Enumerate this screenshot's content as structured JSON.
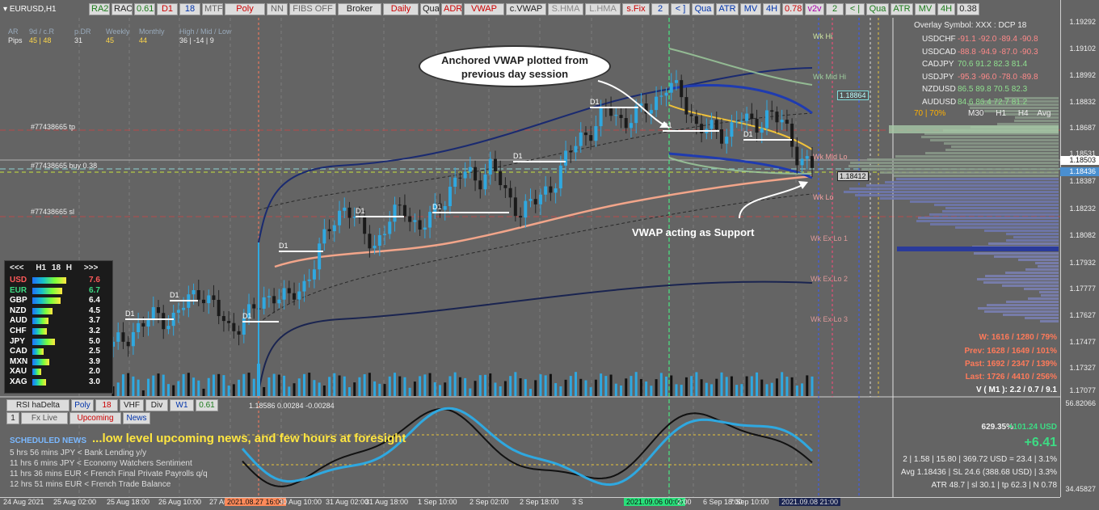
{
  "symbol": "EURUSD,H1",
  "toolbar": [
    "RA2",
    "RAC",
    "0.61",
    "D1",
    "18",
    "MTF",
    "Poly",
    "NN",
    "FIBS OFF",
    "Broker",
    "Daily",
    "Qua",
    "ADR",
    "VWAP",
    "c.VWAP",
    "S.HMA",
    "L.HMA",
    "s.Fix",
    "2",
    "< ]",
    "Qua",
    "ATR",
    "MV",
    "4H",
    "0.78",
    "v2v",
    "2",
    "< |",
    "Qua",
    "ATR",
    "MV",
    "4H",
    "0.38"
  ],
  "stats": {
    "header": [
      "AR",
      "9d / c.R",
      "p.DR",
      "Weekly",
      "Monthly",
      "High / Mid / Low"
    ],
    "pips_label": "Pips",
    "values": [
      "45 | 48",
      "31",
      "45",
      "44",
      "36 | -14 | 9"
    ]
  },
  "trade_lines": {
    "tp": "#77438665 tp",
    "buy": "#77438665 buy 0.38",
    "sl": "#77438665 sl"
  },
  "callouts": {
    "vwap_anchor": "Anchored VWAP plotted from previous day session",
    "vwap_support": "VWAP acting as Support"
  },
  "levels": [
    "Wk Hi",
    "Wk Mid Hi",
    "Wk Mid Lo",
    "Wk Lo",
    "Wk Ex Lo 1",
    "Wk Ex Lo 2",
    "Wk Ex Lo 3"
  ],
  "price_boxes": {
    "upper": "1.18864",
    "lower": "1.18412"
  },
  "d1_label": "D1",
  "strength": {
    "header": [
      "<<<",
      "H1",
      "18",
      "H",
      ">>>"
    ],
    "rows": [
      {
        "ccy": "USD",
        "val": "7.6",
        "color": "#ff5a5a"
      },
      {
        "ccy": "EUR",
        "val": "6.7",
        "color": "#3ddc84"
      },
      {
        "ccy": "GBP",
        "val": "6.4",
        "color": "#ffffff"
      },
      {
        "ccy": "NZD",
        "val": "4.5",
        "color": "#ffffff"
      },
      {
        "ccy": "AUD",
        "val": "3.7",
        "color": "#ffffff"
      },
      {
        "ccy": "CHF",
        "val": "3.2",
        "color": "#ffffff"
      },
      {
        "ccy": "JPY",
        "val": "5.0",
        "color": "#ffffff"
      },
      {
        "ccy": "CAD",
        "val": "2.5",
        "color": "#ffffff"
      },
      {
        "ccy": "MXN",
        "val": "3.9",
        "color": "#ffffff"
      },
      {
        "ccy": "XAU",
        "val": "2.0",
        "color": "#ffffff"
      },
      {
        "ccy": "XAG",
        "val": "3.0",
        "color": "#ffffff"
      }
    ]
  },
  "overlay": {
    "title": "Overlay Symbol: XXX : DCP 18",
    "rows": [
      {
        "sym": "USDCHF",
        "vals": "-91.1  -92.0  -89.4  -90.8",
        "color": "#ff8a8a"
      },
      {
        "sym": "USDCAD",
        "vals": "-88.8  -94.9  -87.0  -90.3",
        "color": "#ff8a8a"
      },
      {
        "sym": "CADJPY",
        "vals": "70.6  91.2  82.3  81.4",
        "color": "#8fe08f"
      },
      {
        "sym": "USDJPY",
        "vals": "-95.3  -96.0  -78.0  -89.8",
        "color": "#ff8a8a"
      },
      {
        "sym": "NZDUSD",
        "vals": "86.5  89.8  70.5  82.3",
        "color": "#8fe08f"
      },
      {
        "sym": "AUDUSD",
        "vals": "84.6  86.4  72.7  81.2",
        "color": "#8fe08f"
      }
    ],
    "footer_pct": "70 | 70%",
    "footer_cols": [
      "M30",
      "H1",
      "H4",
      "Avg"
    ]
  },
  "perf": {
    "w": "W: 1616 / 1280 / 79%",
    "prev": "Prev: 1628 / 1649 / 101%",
    "past": "Past: 1692 / 2347 / 139%",
    "last": "Last: 1726 / 4410 / 256%",
    "v": "V ( M1 ): 2.2 / 0.7 / 9.1"
  },
  "y_axis": [
    "1.19292",
    "1.19102",
    "1.18992",
    "1.18832",
    "1.18687",
    "1.18531",
    "1.18503",
    "1.18436",
    "1.18387",
    "1.18232",
    "1.18082",
    "1.17932",
    "1.17777",
    "1.17627",
    "1.17477",
    "1.17327",
    "1.17077"
  ],
  "y_axis_hl": {
    "price": "1.18503",
    "bid": "1.18436"
  },
  "sub_y_axis": [
    "56.82066",
    "34.45827"
  ],
  "x_axis": [
    "24 Aug 2021",
    "25 Aug 02:00",
    "25 Aug 18:00",
    "26 Aug 10:00",
    "27 Aug",
    "2021.08.27 16:00",
    "30 Aug 10:00",
    "31 Aug 02:00",
    "31 Aug 18:00",
    "1 Sep 10:00",
    "2 Sep 02:00",
    "2 Sep 18:00",
    "3 S",
    "2021.09.06 00:00",
    "2:00",
    "6 Sep 18:00",
    "7 Sep 10:00",
    "2021.09.08 21:00"
  ],
  "sub_toolbar": [
    "RSI haDelta",
    "Poly",
    "18",
    "VHF",
    "Div",
    "W1",
    "0.61"
  ],
  "sub_values": "1.18586 0.00284 -0.00284",
  "sub_tabs": [
    "1",
    "Fx Live",
    "Upcoming",
    "News"
  ],
  "news": {
    "title": "SCHEDULED NEWS",
    "comment": "...low level upcoming news, and few hours at foresight",
    "items": [
      "5 hrs 56 mins  JPY  <  Bank Lending y/y",
      "11 hrs 6 mins  JPY  <  Economy Watchers Sentiment",
      "11 hrs 36 mins  EUR  <  French Final Private Payrolls q/q",
      "12 hrs 51 mins  EUR  <  French Trade Balance"
    ]
  },
  "account": {
    "pct": "629.35%",
    "usd": "+101.24 USD",
    "pl": "+6.41",
    "line1": "2  |  1.58  |  15.80  |  369.72 USD = 23.4  |  3.1%",
    "line2": "Avg 1.18436  |  SL 24.6 (388.68 USD)  |  3.3%",
    "line3": "ATR 48.7  |  sl 30.1  |  tp 62.3  |  N 0.78"
  },
  "chart_data": {
    "type": "candlestick",
    "symbol": "EURUSD",
    "timeframe": "H1",
    "ylim": [
      1.1705,
      1.1935
    ],
    "close_series": [
      1.1735,
      1.1742,
      1.1748,
      1.1755,
      1.175,
      1.1762,
      1.177,
      1.1758,
      1.1745,
      1.1752,
      1.176,
      1.1768,
      1.1763,
      1.1771,
      1.179,
      1.181,
      1.1822,
      1.1805,
      1.1797,
      1.1812,
      1.182,
      1.1806,
      1.1815,
      1.183,
      1.1841,
      1.1836,
      1.1846,
      1.1826,
      1.1818,
      1.1823,
      1.1832,
      1.1847,
      1.1862,
      1.1868,
      1.188,
      1.1872,
      1.1876,
      1.1882,
      1.1894,
      1.1888,
      1.187,
      1.1866,
      1.1864,
      1.1875,
      1.1868,
      1.1878,
      1.187,
      1.1852,
      1.1844
    ],
    "annotations": [
      "Anchored VWAP plotted from previous day session",
      "VWAP acting as Support"
    ]
  }
}
